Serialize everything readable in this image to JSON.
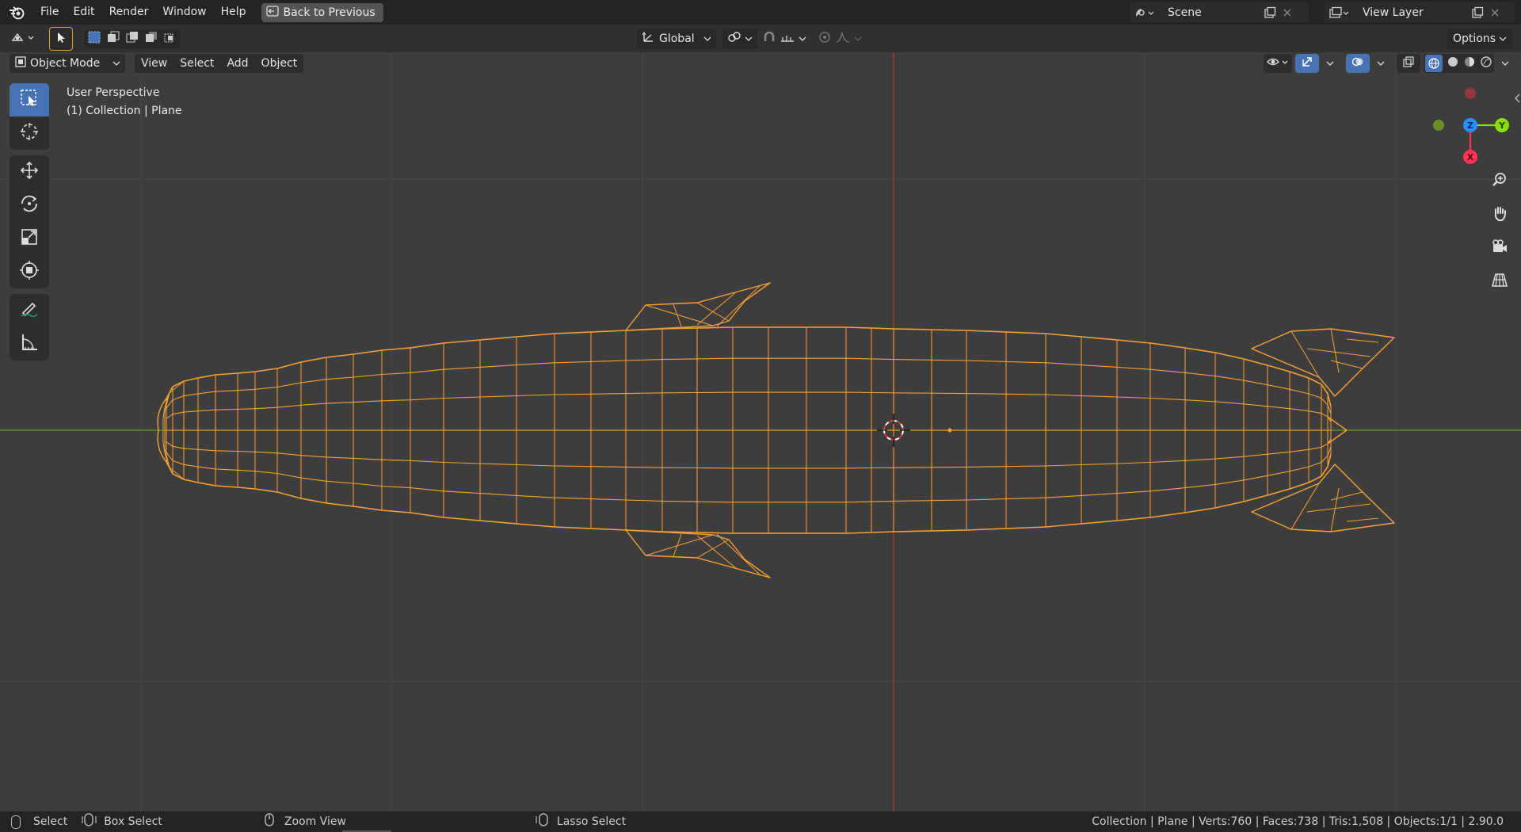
{
  "topbar": {
    "menu": [
      "File",
      "Edit",
      "Render",
      "Window",
      "Help"
    ],
    "back_label": "Back to Previous",
    "scene_name": "Scene",
    "view_layer": "View Layer"
  },
  "header": {
    "transform_orientation": "Global",
    "options_label": "Options"
  },
  "viewport_header": {
    "mode": "Object Mode",
    "menus": [
      "View",
      "Select",
      "Add",
      "Object"
    ]
  },
  "overlay": {
    "perspective": "User Perspective",
    "collection": "(1) Collection | Plane"
  },
  "gizmo": {
    "axes": {
      "x": "X",
      "y": "Y",
      "z": "Z"
    },
    "colors": {
      "x": "#ff3352",
      "y": "#8bdc00",
      "z": "#2890ff"
    }
  },
  "statusbar": {
    "select": "Select",
    "box_select": "Box Select",
    "zoom_view": "Zoom View",
    "lasso_select": "Lasso Select",
    "stats": "Collection | Plane | Verts:760 | Faces:738 | Tris:1,508 | Objects:1/1 | 2.90.0"
  },
  "colors": {
    "viewport_bg": "#3d3d3d",
    "wire_selected": "#f5a035",
    "axis_x": "#b53a3a",
    "axis_y": "#6a9a32",
    "active_tool": "#4772b3"
  }
}
